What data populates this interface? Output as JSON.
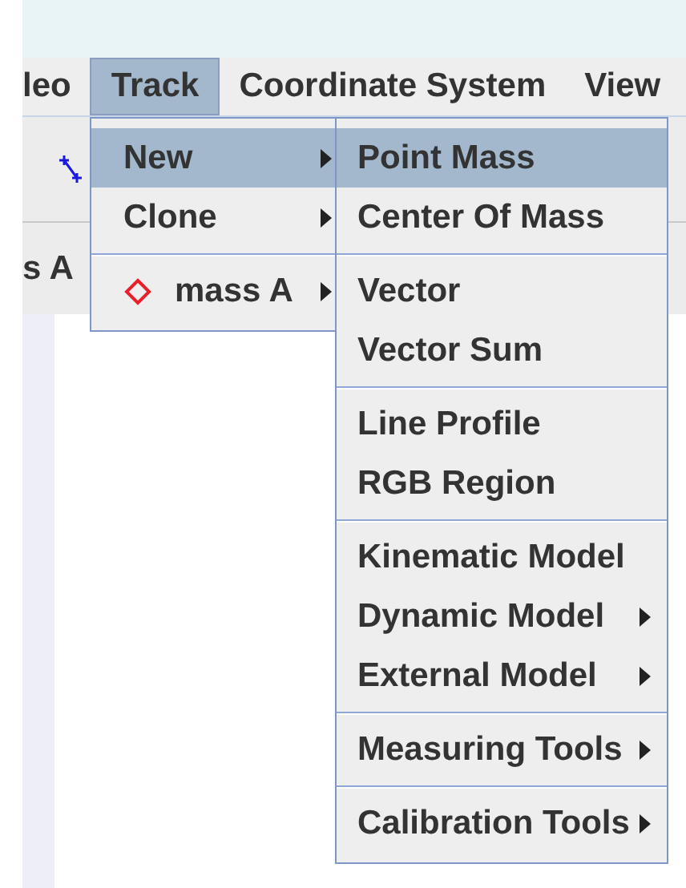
{
  "menubar": [
    {
      "label": "leo",
      "selected": false
    },
    {
      "label": "Track",
      "selected": true
    },
    {
      "label": "Coordinate System",
      "selected": false
    },
    {
      "label": "View",
      "selected": false
    }
  ],
  "tab_label": "s A",
  "track_menu": [
    {
      "kind": "item",
      "label": "New",
      "submenu": true,
      "selected": true
    },
    {
      "kind": "item",
      "label": "Clone",
      "submenu": true,
      "selected": false
    },
    {
      "kind": "separator"
    },
    {
      "kind": "track",
      "label": "mass A",
      "submenu": true,
      "selected": false,
      "color": "#e8202a"
    }
  ],
  "new_submenu": [
    {
      "kind": "item",
      "label": "Point Mass",
      "submenu": false,
      "selected": true
    },
    {
      "kind": "item",
      "label": "Center Of Mass",
      "submenu": false,
      "selected": false
    },
    {
      "kind": "separator"
    },
    {
      "kind": "item",
      "label": "Vector",
      "submenu": false,
      "selected": false
    },
    {
      "kind": "item",
      "label": "Vector Sum",
      "submenu": false,
      "selected": false
    },
    {
      "kind": "separator"
    },
    {
      "kind": "item",
      "label": "Line Profile",
      "submenu": false,
      "selected": false
    },
    {
      "kind": "item",
      "label": "RGB Region",
      "submenu": false,
      "selected": false
    },
    {
      "kind": "separator"
    },
    {
      "kind": "item",
      "label": "Kinematic Model",
      "submenu": false,
      "selected": false
    },
    {
      "kind": "item",
      "label": "Dynamic Model",
      "submenu": true,
      "selected": false
    },
    {
      "kind": "item",
      "label": "External Model",
      "submenu": true,
      "selected": false
    },
    {
      "kind": "separator"
    },
    {
      "kind": "item",
      "label": "Measuring Tools",
      "submenu": true,
      "selected": false
    },
    {
      "kind": "separator"
    },
    {
      "kind": "item",
      "label": "Calibration Tools",
      "submenu": true,
      "selected": false
    }
  ]
}
